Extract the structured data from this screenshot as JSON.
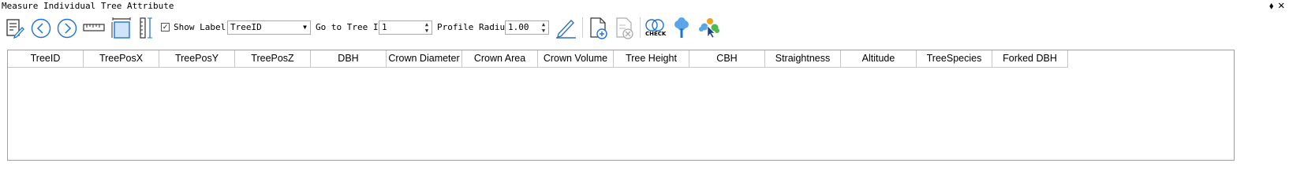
{
  "window": {
    "title": "Measure Individual Tree Attribute",
    "pin_glyph": "⬧",
    "close_glyph": "✕"
  },
  "toolbar": {
    "edit_icon": "edit-document-icon",
    "prev_icon": "chevron-left-circle-icon",
    "next_icon": "chevron-right-circle-icon",
    "ruler_icon": "ruler-icon",
    "measure_box_icon": "measure-box-icon",
    "vertical_ruler_icon": "vertical-ruler-icon",
    "show_label": {
      "checked": true,
      "label": "Show Label:",
      "selected": "TreeID"
    },
    "goto": {
      "label": "Go to Tree ID:",
      "value": "1"
    },
    "profile_radius": {
      "label": "Profile Radius:",
      "value": "1.00"
    },
    "check_label": "CHECK",
    "accent": "#1e73d2",
    "pencil_color": "#2f6fbf"
  },
  "table": {
    "columns": [
      "TreeID",
      "TreePosX",
      "TreePosY",
      "TreePosZ",
      "DBH",
      "Crown Diameter",
      "Crown Area",
      "Crown Volume",
      "Tree Height",
      "CBH",
      "Straightness",
      "Altitude",
      "TreeSpecies",
      "Forked DBH"
    ],
    "rows": []
  }
}
